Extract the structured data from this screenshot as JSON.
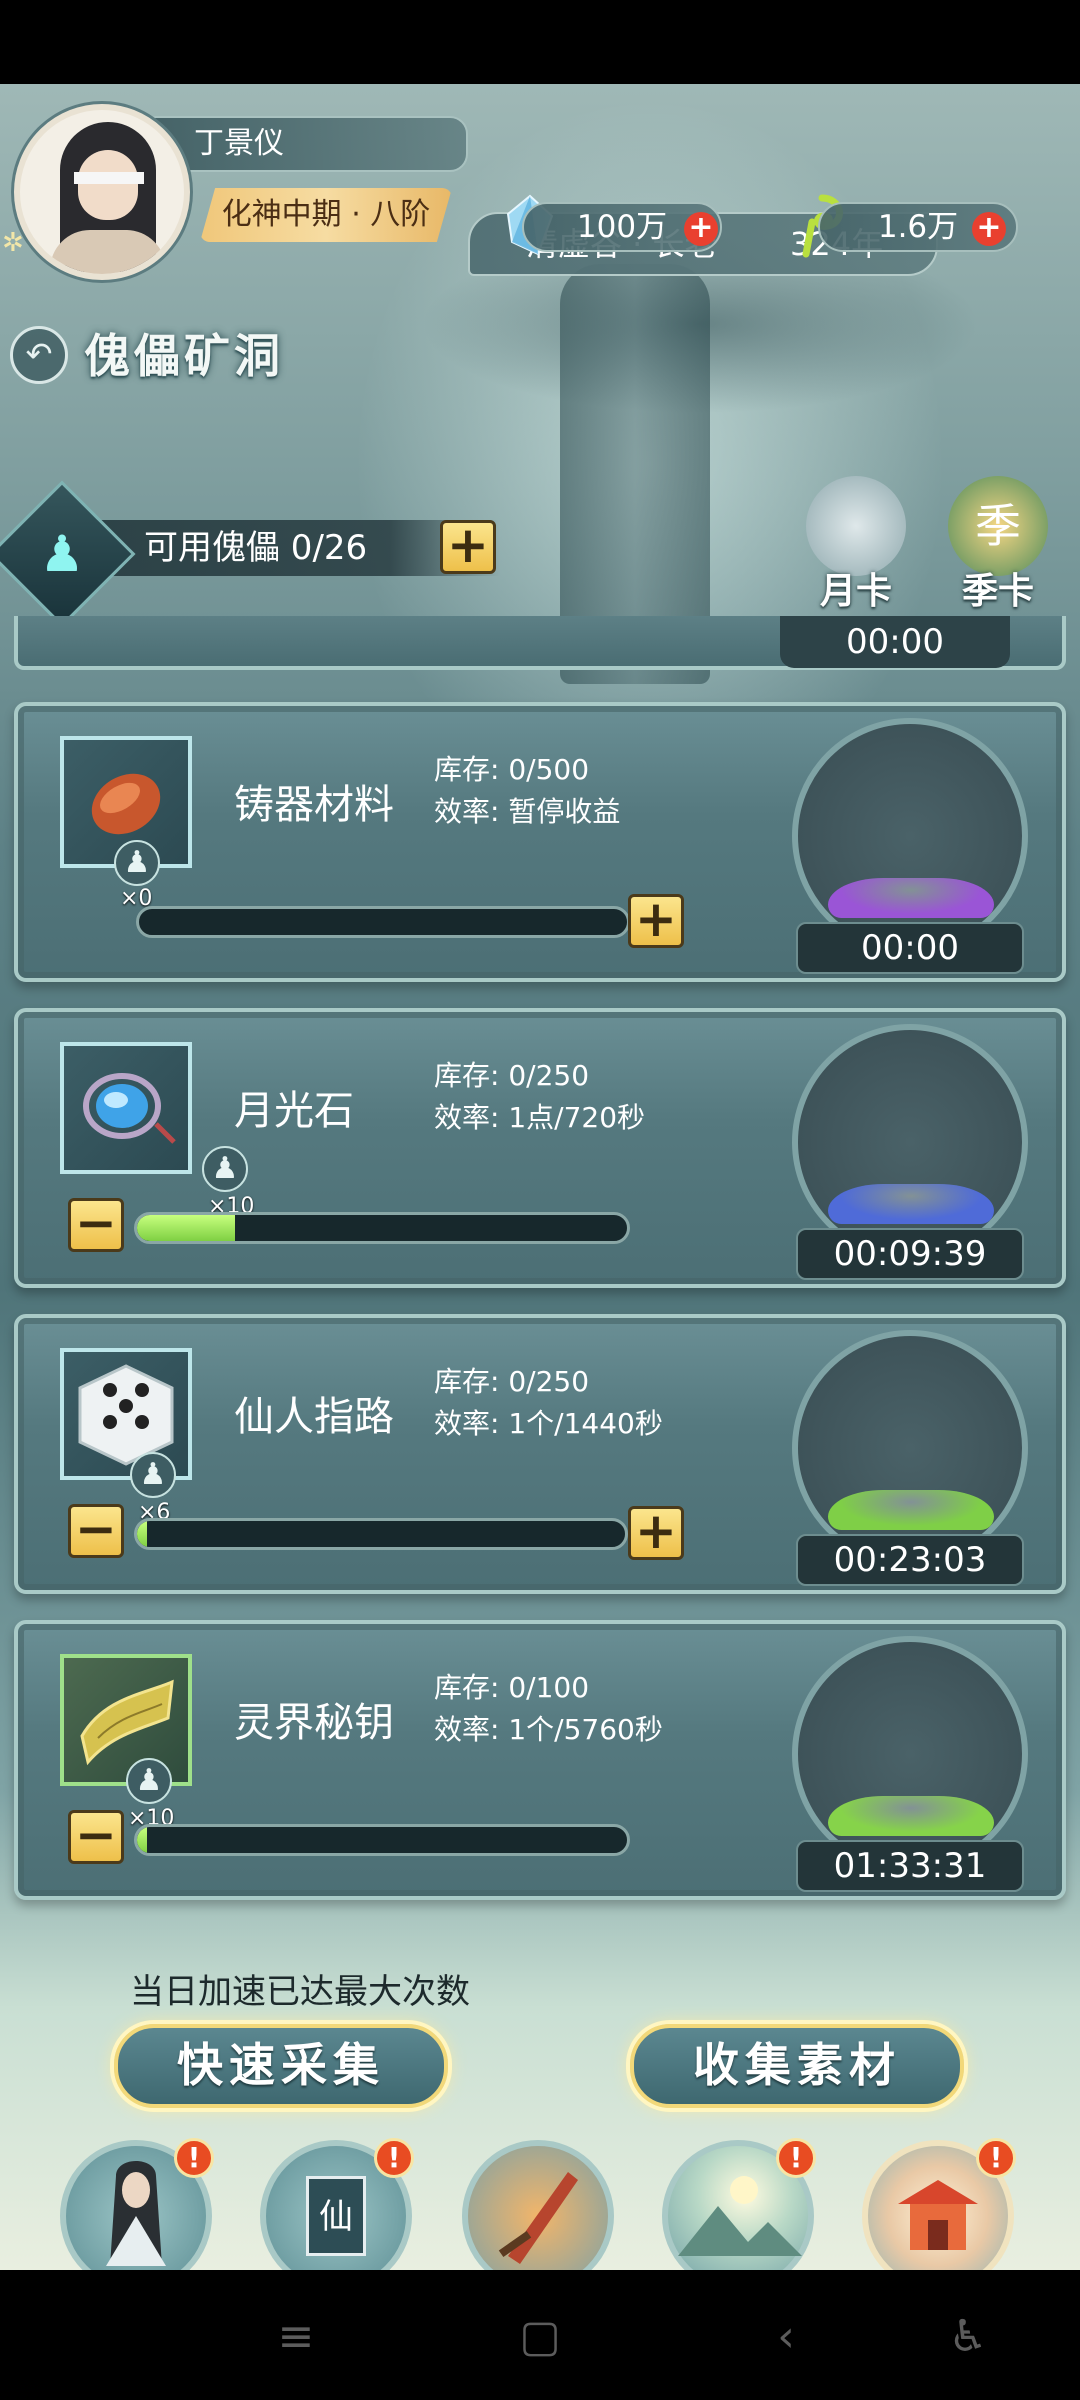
{
  "player": {
    "name": "丁景仪",
    "rank": "化神中期 · 八阶",
    "sect": "清虚谷 · 长老",
    "age": "324年"
  },
  "currencies": [
    {
      "icon": "blue-crystal-icon",
      "value": "100万"
    },
    {
      "icon": "green-spirit-icon",
      "value": "1.6万"
    }
  ],
  "page": {
    "title": "傀儡矿洞",
    "available_puppets_label": "可用傀儡 0/26"
  },
  "cards": {
    "monthly": "月卡",
    "season": "季卡",
    "season_emblem": "季"
  },
  "partial_row": {
    "timer": "00:00"
  },
  "mines": [
    {
      "name": "铸器材料",
      "stock": "库存: 0/500",
      "rate": "效率: 暂停收益",
      "puppets": "×0",
      "progress": 0.0,
      "timer": "00:00",
      "ore_color": "#9a55d6",
      "icon": "ore-chunk-icon"
    },
    {
      "name": "月光石",
      "stock": "库存: 0/250",
      "rate": "效率: 1点/720秒",
      "puppets": "×10",
      "progress": 0.2,
      "timer": "00:09:39",
      "ore_color": "#4f6bd8",
      "icon": "moonstone-icon"
    },
    {
      "name": "仙人指路",
      "stock": "库存: 0/250",
      "rate": "效率: 1个/1440秒",
      "puppets": "×6",
      "progress": 0.02,
      "timer": "00:23:03",
      "ore_color": "#7fcf47",
      "icon": "dice-icon"
    },
    {
      "name": "灵界秘钥",
      "stock": "库存: 0/100",
      "rate": "效率: 1个/5760秒",
      "puppets": "×10",
      "progress": 0.02,
      "timer": "01:33:31",
      "ore_color": "#86d34a",
      "icon": "scroll-icon"
    }
  ],
  "notice": "当日加速已达最大次数",
  "buttons": {
    "fast_collect": "快速采集",
    "collect_material": "收集素材"
  },
  "nav": [
    {
      "label": "角色",
      "icon": "character-icon",
      "alert": "!"
    },
    {
      "label": "仙门",
      "icon": "sect-banner-icon",
      "alert": "!"
    },
    {
      "label": "战斗",
      "icon": "sword-icon",
      "alert": ""
    },
    {
      "label": "世界",
      "icon": "world-icon",
      "alert": "!"
    },
    {
      "label": "洞府",
      "icon": "cave-residence-icon",
      "alert": "!"
    }
  ],
  "symbols": {
    "plus": "+",
    "minus": "−",
    "red_plus": "+",
    "sect_glyph": "仙"
  }
}
